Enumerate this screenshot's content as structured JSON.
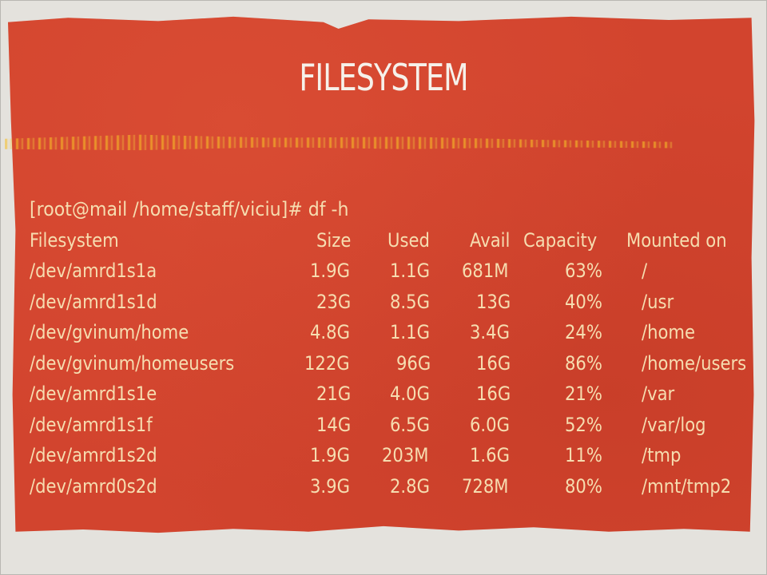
{
  "slide": {
    "title": "FILESYSTEM",
    "colors": {
      "background": "#d2442e",
      "title_text": "#f6f1ea",
      "body_text": "#f6ddb0",
      "streak": "#f5be28"
    }
  },
  "terminal": {
    "prompt_line": "[root@mail /home/staff/viciu]# df -h",
    "columns": [
      "Filesystem",
      "Size",
      "Used",
      "Avail",
      "Capacity",
      "Mounted on"
    ],
    "rows": [
      [
        "/dev/amrd1s1a",
        "1.9G",
        "1.1G",
        "681M",
        "63%",
        "/"
      ],
      [
        "/dev/amrd1s1d",
        "23G",
        "8.5G",
        "13G",
        "40%",
        "/usr"
      ],
      [
        "/dev/gvinum/home",
        "4.8G",
        "1.1G",
        "3.4G",
        "24%",
        "/home"
      ],
      [
        "/dev/gvinum/homeusers",
        "122G",
        "96G",
        "16G",
        "86%",
        "/home/users"
      ],
      [
        "/dev/amrd1s1e",
        "21G",
        "4.0G",
        "16G",
        "21%",
        "/var"
      ],
      [
        "/dev/amrd1s1f",
        "14G",
        "6.5G",
        "6.0G",
        "52%",
        "/var/log"
      ],
      [
        "/dev/amrd1s2d",
        "1.9G",
        "203M",
        "1.6G",
        "11%",
        "/tmp"
      ],
      [
        "/dev/amrd0s2d",
        "3.9G",
        "2.8G",
        "728M",
        "80%",
        "/mnt/tmp2"
      ]
    ]
  }
}
